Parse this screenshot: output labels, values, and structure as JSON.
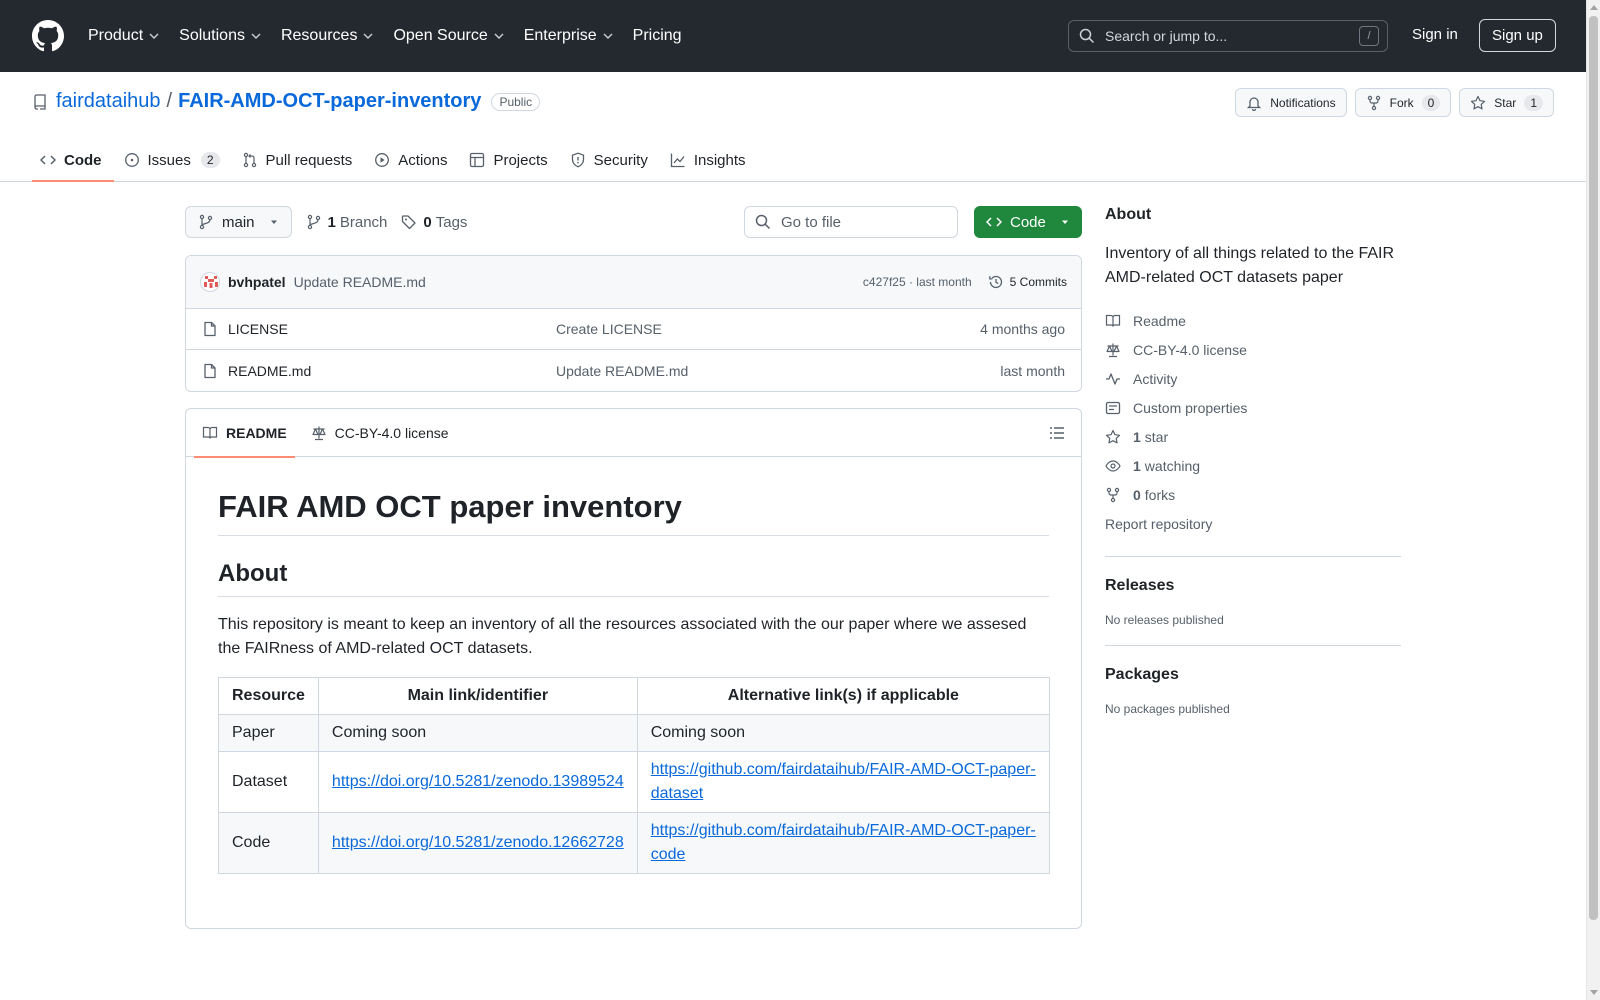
{
  "header": {
    "nav": [
      {
        "label": "Product",
        "has_menu": true
      },
      {
        "label": "Solutions",
        "has_menu": true
      },
      {
        "label": "Resources",
        "has_menu": true
      },
      {
        "label": "Open Source",
        "has_menu": true
      },
      {
        "label": "Enterprise",
        "has_menu": true
      },
      {
        "label": "Pricing",
        "has_menu": false
      }
    ],
    "search_placeholder": "Search or jump to...",
    "search_key": "/",
    "sign_in": "Sign in",
    "sign_up": "Sign up"
  },
  "repo": {
    "owner": "fairdataihub",
    "separator": "/",
    "name": "FAIR-AMD-OCT-paper-inventory",
    "visibility": "Public",
    "notifications_label": "Notifications",
    "fork_label": "Fork",
    "fork_count": "0",
    "star_label": "Star",
    "star_count": "1"
  },
  "tabs": [
    {
      "label": "Code",
      "icon": "code-icon",
      "active": true
    },
    {
      "label": "Issues",
      "icon": "issue-icon",
      "counter": "2"
    },
    {
      "label": "Pull requests",
      "icon": "pull-request-icon"
    },
    {
      "label": "Actions",
      "icon": "play-icon"
    },
    {
      "label": "Projects",
      "icon": "table-icon"
    },
    {
      "label": "Security",
      "icon": "shield-icon"
    },
    {
      "label": "Insights",
      "icon": "graph-icon"
    }
  ],
  "toolbar": {
    "branch": "main",
    "branch_count": "1",
    "branch_word": "Branch",
    "tag_count": "0",
    "tag_word": "Tags",
    "go_to_file": "Go to file",
    "code_button": "Code"
  },
  "commit": {
    "author": "bvhpatel",
    "message": "Update README.md",
    "meta": "c427f25 · last month",
    "commits_label": "5 Commits"
  },
  "files": [
    {
      "name": "LICENSE",
      "message": "Create LICENSE",
      "date": "4 months ago"
    },
    {
      "name": "README.md",
      "message": "Update README.md",
      "date": "last month"
    }
  ],
  "readme": {
    "tab_readme": "README",
    "tab_license": "CC-BY-4.0 license",
    "h1": "FAIR AMD OCT paper inventory",
    "h2": "About",
    "paragraph": "This repository is meant to keep an inventory of all the resources associated with the our paper where we assesed the FAIRness of AMD-related OCT datasets.",
    "table": {
      "headers": [
        "Resource",
        "Main link/identifier",
        "Alternative link(s) if applicable"
      ],
      "rows": [
        [
          "Paper",
          "Coming soon",
          "Coming soon"
        ],
        [
          "Dataset",
          "https://doi.org/10.5281/zenodo.13989524",
          "https://github.com/fairdataihub/FAIR-AMD-OCT-paper-dataset"
        ],
        [
          "Code",
          "https://doi.org/10.5281/zenodo.12662728",
          "https://github.com/fairdataihub/FAIR-AMD-OCT-paper-code"
        ]
      ]
    }
  },
  "sidebar": {
    "about_title": "About",
    "description": "Inventory of all things related to the FAIR AMD-related OCT datasets paper",
    "items": [
      {
        "icon": "book-icon",
        "label": "Readme"
      },
      {
        "icon": "law-icon",
        "label": "CC-BY-4.0 license"
      },
      {
        "icon": "pulse-icon",
        "label": "Activity"
      },
      {
        "icon": "note-icon",
        "label": "Custom properties"
      },
      {
        "icon": "star-icon",
        "count": "1",
        "label": "star"
      },
      {
        "icon": "eye-icon",
        "count": "1",
        "label": "watching"
      },
      {
        "icon": "fork-icon",
        "count": "0",
        "label": "forks"
      }
    ],
    "report": "Report repository",
    "releases_title": "Releases",
    "releases_empty": "No releases published",
    "packages_title": "Packages",
    "packages_empty": "No packages published"
  },
  "colors": {
    "header_bg": "#24292f",
    "link": "#0969da",
    "primary_button": "#1f883d",
    "active_tab_underline": "#fd8c73"
  }
}
